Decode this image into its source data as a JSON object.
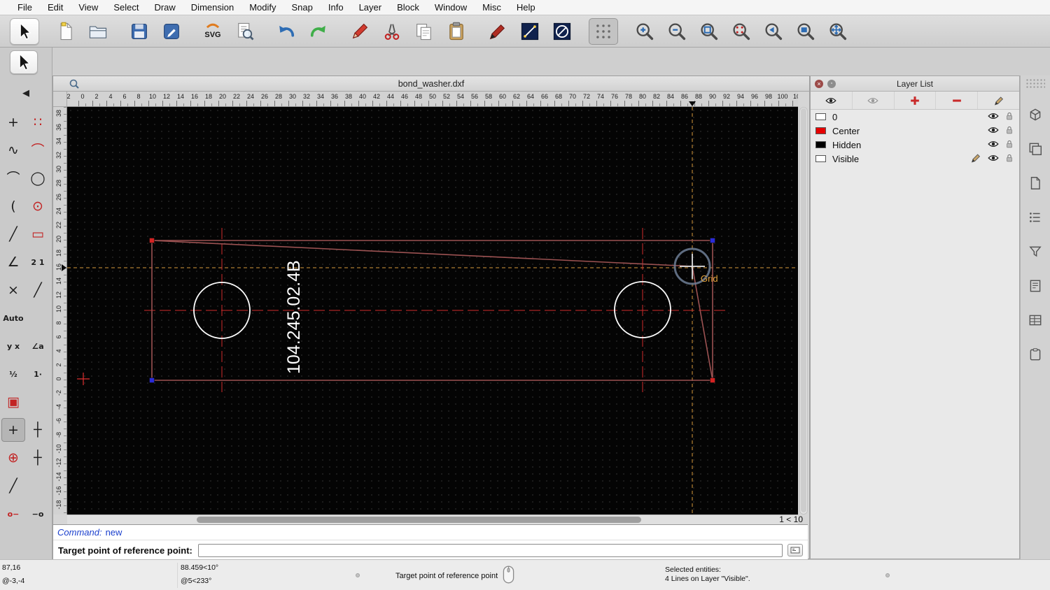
{
  "menu": {
    "items": [
      "File",
      "Edit",
      "View",
      "Select",
      "Draw",
      "Dimension",
      "Modify",
      "Snap",
      "Info",
      "Layer",
      "Block",
      "Window",
      "Misc",
      "Help"
    ]
  },
  "toolbar": {
    "buttons": [
      {
        "name": "pointer-tool",
        "icon": "pointer",
        "raised": true
      },
      {
        "sep": true
      },
      {
        "name": "new-file-button",
        "icon": "new"
      },
      {
        "name": "open-file-button",
        "icon": "open"
      },
      {
        "sep": true
      },
      {
        "name": "save-file-button",
        "icon": "save"
      },
      {
        "name": "drawing-preferences-button",
        "icon": "editdoc"
      },
      {
        "sep": true
      },
      {
        "name": "svg-export-button",
        "icon": "svg"
      },
      {
        "name": "print-preview-button",
        "icon": "preview"
      },
      {
        "sep": true
      },
      {
        "name": "undo-button",
        "icon": "undo"
      },
      {
        "name": "redo-button",
        "icon": "redo"
      },
      {
        "sep": true
      },
      {
        "name": "draw-pen-button",
        "icon": "penred"
      },
      {
        "name": "cut-button",
        "icon": "cut"
      },
      {
        "name": "copy-button",
        "icon": "copy"
      },
      {
        "name": "paste-button",
        "icon": "paste"
      },
      {
        "sep": true
      },
      {
        "name": "pen-attributes-button",
        "icon": "pen2"
      },
      {
        "name": "line-attributes-button",
        "icon": "lineattr"
      },
      {
        "name": "no-fill-button",
        "icon": "circleslash"
      },
      {
        "sep": true
      },
      {
        "name": "grid-toggle-button",
        "icon": "grid",
        "pressed": true
      },
      {
        "sep": true
      },
      {
        "name": "zoom-in-button",
        "icon": "zoom",
        "sub": "plus"
      },
      {
        "name": "zoom-out-button",
        "icon": "zoom",
        "sub": "minus"
      },
      {
        "name": "zoom-auto-button",
        "icon": "zoom",
        "sub": "auto"
      },
      {
        "name": "zoom-selection-button",
        "icon": "zoom",
        "sub": "select"
      },
      {
        "name": "zoom-previous-button",
        "icon": "zoom",
        "sub": "prev"
      },
      {
        "name": "zoom-window-button",
        "icon": "zoom",
        "sub": "window"
      },
      {
        "name": "zoom-pan-button",
        "icon": "zoom",
        "sub": "pan"
      }
    ]
  },
  "left_tools": {
    "back_label": "◀",
    "cells": [
      {
        "name": "point-tool",
        "glyph": "+",
        "color": "#1c1c1c"
      },
      {
        "name": "hatch-tool",
        "glyph": "∷",
        "color": "#c22222"
      },
      {
        "name": "spline-tool",
        "glyph": "∿",
        "color": "#1c1c1c"
      },
      {
        "name": "curve-points-tool",
        "glyph": "⌒",
        "color": "#c22222"
      },
      {
        "name": "arc-tool",
        "glyph": "⌒",
        "color": "#1c1c1c"
      },
      {
        "name": "circle-tool",
        "glyph": "◯",
        "color": "#1c1c1c"
      },
      {
        "name": "arc-tangent-tool",
        "glyph": "(",
        "color": "#1c1c1c"
      },
      {
        "name": "circle-center-tool",
        "glyph": "⊙",
        "color": "#c22222"
      },
      {
        "name": "tangent-line-tool",
        "glyph": "╱",
        "color": "#1c1c1c"
      },
      {
        "name": "rectangle-tool",
        "glyph": "▭",
        "color": "#c22222"
      },
      {
        "name": "angle-line-tool",
        "glyph": "∠",
        "color": "#1c1c1c"
      },
      {
        "name": "tangent-two-circles-tool",
        "glyph": "2 1",
        "text": true,
        "color": "#1c1c1c"
      },
      {
        "name": "intersection-tool",
        "glyph": "×",
        "color": "#1c1c1c"
      },
      {
        "name": "divide-tool",
        "glyph": "╱",
        "color": "#1c1c1c"
      },
      {
        "name": "auto-snap-button",
        "glyph": "Auto",
        "text": true,
        "color": "#1c1c1c"
      },
      {
        "empty": true
      },
      {
        "name": "ortho-xy-tool",
        "glyph": "y x",
        "text": true,
        "color": "#1c1c1c"
      },
      {
        "name": "angle-snap-tool",
        "glyph": "∠a",
        "text": true,
        "color": "#1c1c1c"
      },
      {
        "name": "snap-middle-tool",
        "glyph": "½",
        "text": true,
        "color": "#1c1c1c"
      },
      {
        "name": "snap-distance-tool",
        "glyph": "1·",
        "text": true,
        "color": "#1c1c1c"
      },
      {
        "name": "snap-grid-tool",
        "glyph": "▣",
        "color": "#c22222"
      },
      {
        "empty": true
      },
      {
        "name": "snap-free-tool",
        "glyph": "+",
        "color": "#1c1c1c",
        "selected": true
      },
      {
        "name": "snap-endpoint-tool",
        "glyph": "┼",
        "color": "#1c1c1c"
      },
      {
        "name": "snap-center-tool",
        "glyph": "⊕",
        "color": "#c22222"
      },
      {
        "name": "snap-intersection-tool",
        "glyph": "┼",
        "color": "#1c1c1c"
      },
      {
        "name": "snap-on-entity-tool",
        "glyph": "╱",
        "color": "#1c1c1c"
      },
      {
        "empty": true
      },
      {
        "name": "restrict-horizontal-tool",
        "glyph": "o−",
        "text": true,
        "color": "#c22222"
      },
      {
        "name": "restrict-vertical-tool",
        "glyph": "−o",
        "text": true,
        "color": "#1c1c1c"
      }
    ]
  },
  "drawing": {
    "title": "bond_washer.dxf",
    "part_label": "104.245.02.4B",
    "grid_snap_label": "Grid",
    "grid_status": "1 < 10",
    "ruler_top": [
      "2",
      "0",
      "2",
      "4",
      "6",
      "8",
      "10",
      "12",
      "14",
      "16",
      "18",
      "20",
      "22",
      "24",
      "26",
      "28",
      "30",
      "32",
      "34",
      "36",
      "38",
      "40",
      "42",
      "44",
      "46",
      "48",
      "50",
      "52",
      "54",
      "56",
      "58",
      "60",
      "62",
      "64",
      "66",
      "68",
      "70",
      "72",
      "74",
      "76",
      "78",
      "80",
      "82",
      "84",
      "86",
      "88",
      "90",
      "92",
      "94",
      "96",
      "98",
      "100",
      "10"
    ],
    "ruler_left": [
      "38",
      "36",
      "34",
      "32",
      "30",
      "28",
      "26",
      "24",
      "22",
      "20",
      "18",
      "16",
      "14",
      "12",
      "10",
      "8",
      "6",
      "4",
      "2",
      "0",
      "-2",
      "-4",
      "-6",
      "-8",
      "-10",
      "-12",
      "-14",
      "-16",
      "-18"
    ]
  },
  "layer_panel": {
    "title": "Layer List",
    "toolbar": [
      {
        "name": "show-all-layers-button",
        "icon": "eye"
      },
      {
        "name": "hide-all-layers-button",
        "icon": "eyeoff"
      },
      {
        "name": "add-layer-button",
        "icon": "plus"
      },
      {
        "name": "remove-layer-button",
        "icon": "minus"
      },
      {
        "name": "edit-layer-button",
        "icon": "pensmall"
      }
    ],
    "layers": [
      {
        "name": "0",
        "color": "#ffffff",
        "active": false
      },
      {
        "name": "Center",
        "color": "#e60000",
        "active": false
      },
      {
        "name": "Hidden",
        "color": "#000000",
        "active": false
      },
      {
        "name": "Visible",
        "color": "#ffffff",
        "active": true
      }
    ]
  },
  "right_strip": {
    "icons": [
      {
        "name": "property-editor-panel-toggle",
        "icon": "cube"
      },
      {
        "name": "layer-list-panel-toggle",
        "icon": "stack"
      },
      {
        "name": "block-list-panel-toggle",
        "icon": "sheet"
      },
      {
        "name": "view-list-panel-toggle",
        "icon": "list"
      },
      {
        "name": "selection-filter-panel-toggle",
        "icon": "funnel"
      },
      {
        "name": "library-browser-panel-toggle",
        "icon": "doc"
      },
      {
        "name": "command-history-panel-toggle",
        "icon": "table"
      },
      {
        "name": "clipboard-panel-toggle",
        "icon": "clipboard"
      }
    ]
  },
  "command": {
    "history_prompt": "Command:",
    "history_value": "new",
    "prompt_label": "Target point of reference point:",
    "input_value": ""
  },
  "status": {
    "abs": "87,16",
    "rel": "@-3,-4",
    "abs_polar": "88.459<10°",
    "rel_polar": "@5<233°",
    "hint": "Target point of reference point",
    "sel_title": "Selected entities:",
    "sel_detail": "4 Lines on Layer \"Visible\"."
  },
  "colors": {
    "outline": "#9c5252",
    "centerline": "#d02b2b",
    "snap_crosshair": "#d99a3d",
    "hole": "#ffffff",
    "handle_red": "#d42222",
    "handle_blue": "#2a2ad8"
  }
}
